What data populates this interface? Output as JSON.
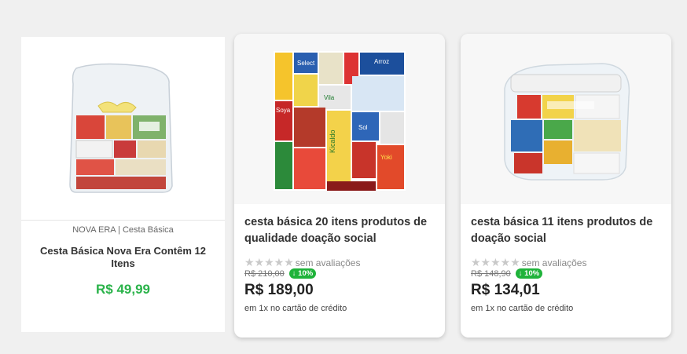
{
  "products": [
    {
      "brand_line": "NOVA ERA | Cesta Básica",
      "title": "Cesta Básica Nova Era Contêm 12 Itens",
      "price": "R$ 49,99"
    },
    {
      "title": "cesta básica 20 itens produtos de qualidade doação social",
      "stars": "★★★★★",
      "rating_text": "sem avaliações",
      "old_price": "R$ 210,00",
      "discount": "↓ 10%",
      "price": "R$ 189,00",
      "installments": "em 1x no cartão de crédito",
      "image_labels": [
        "Select",
        "Soya",
        "Vila",
        "Kicaldo",
        "Yoki",
        "Sol",
        "Arroz"
      ]
    },
    {
      "title": "cesta básica 11 itens produtos de doação social",
      "stars": "★★★★★",
      "rating_text": "sem avaliações",
      "old_price": "R$ 148,90",
      "discount": "↓ 10%",
      "price": "R$ 134,01",
      "installments": "em 1x no cartão de crédito"
    }
  ],
  "colors": {
    "price_green": "#2ab34a",
    "badge_green": "#1fb33a",
    "star_grey": "#c9c9c9"
  }
}
